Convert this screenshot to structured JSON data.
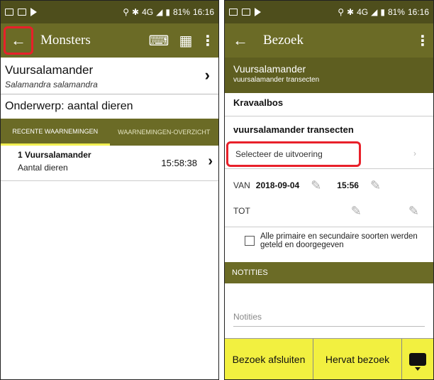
{
  "status_left": {
    "time": "16:16",
    "battery": "81%",
    "network": "4G"
  },
  "status_right": {
    "time": "16:16",
    "battery": "81%",
    "network": "4G"
  },
  "left": {
    "toolbar": {
      "title": "Monsters"
    },
    "species": {
      "name": "Vuursalamander",
      "latin": "Salamandra salamandra"
    },
    "subject": "Onderwerp: aantal dieren",
    "tabs": [
      {
        "label": "RECENTE WAARNEMINGEN",
        "active": true
      },
      {
        "label": "WAARNEMINGEN-OVERZICHT",
        "active": false
      }
    ],
    "observation": {
      "title": "1 Vuursalamander",
      "subtitle": "Aantal dieren",
      "time": "15:58:38"
    }
  },
  "right": {
    "toolbar": {
      "title": "Bezoek"
    },
    "visit": {
      "title": "Vuursalamander",
      "subtitle": "vuursalamander transecten"
    },
    "location": "Kravaalbos",
    "transect": "vuursalamander transecten",
    "select_exec": "Selecteer de uitvoering",
    "from": {
      "label": "VAN",
      "date": "2018-09-04",
      "time": "15:56"
    },
    "to": {
      "label": "TOT"
    },
    "checkbox_label": "Alle primaire en secundaire soorten werden geteld en doorgegeven",
    "notes_header": "NOTITIES",
    "notes_placeholder": "Notities",
    "buttons": {
      "close_visit": "Bezoek afsluiten",
      "resume_visit": "Hervat bezoek"
    }
  },
  "colors": {
    "toolbar": "#6b6b26",
    "statusbar": "#4e4e1c",
    "accent_yellow": "#f2f040",
    "highlight_red": "#e8202a"
  }
}
